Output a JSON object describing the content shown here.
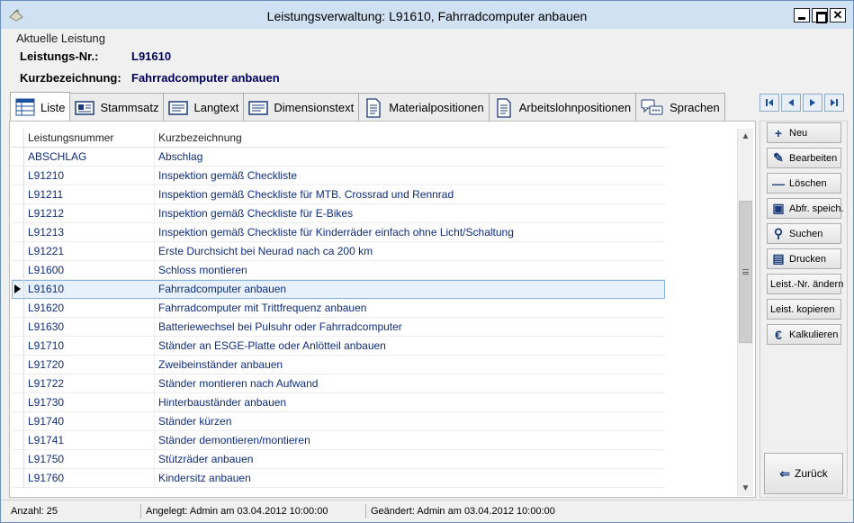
{
  "window": {
    "title": "Leistungsverwaltung: L91610, Fahrradcomputer anbauen"
  },
  "current": {
    "legend": "Aktuelle Leistung",
    "nr_label": "Leistungs-Nr.:",
    "nr_value": "L91610",
    "kurz_label": "Kurzbezeichnung:",
    "kurz_value": "Fahrradcomputer anbauen"
  },
  "tabs": [
    {
      "label": "Liste",
      "icon": "list-grid-icon",
      "active": true
    },
    {
      "label": "Stammsatz",
      "icon": "record-card-icon",
      "active": false
    },
    {
      "label": "Langtext",
      "icon": "text-lines-icon",
      "active": false
    },
    {
      "label": "Dimensionstext",
      "icon": "text-lines-icon",
      "active": false
    },
    {
      "label": "Materialpositionen",
      "icon": "document-icon",
      "active": false
    },
    {
      "label": "Arbeitslohnpositionen",
      "icon": "document-icon",
      "active": false
    },
    {
      "label": "Sprachen",
      "icon": "speech-bubble-icon",
      "active": false
    }
  ],
  "grid": {
    "headers": [
      "Leistungsnummer",
      "Kurzbezeichnung"
    ],
    "rows": [
      [
        "ABSCHLAG",
        "Abschlag"
      ],
      [
        "L91210",
        "Inspektion gemäß Checkliste"
      ],
      [
        "L91211",
        "Inspektion gemäß Checkliste für MTB. Crossrad und Rennrad"
      ],
      [
        "L91212",
        "Inspektion gemäß Checkliste für E-Bikes"
      ],
      [
        "L91213",
        "Inspektion gemäß Checkliste für Kinderräder einfach ohne Licht/Schaltung"
      ],
      [
        "L91221",
        "Erste Durchsicht  bei Neurad nach ca 200 km"
      ],
      [
        "L91600",
        "Schloss montieren"
      ],
      [
        "L91610",
        "Fahrradcomputer anbauen"
      ],
      [
        "L91620",
        "Fahrradcomputer mit Trittfrequenz anbauen"
      ],
      [
        "L91630",
        "Batteriewechsel bei Pulsuhr oder Fahrradcomputer"
      ],
      [
        "L91710",
        "Ständer an ESGE-Platte oder Anlötteil anbauen"
      ],
      [
        "L91720",
        "Zweibeinständer anbauen"
      ],
      [
        "L91722",
        "Ständer montieren nach Aufwand"
      ],
      [
        "L91730",
        "Hinterbauständer anbauen"
      ],
      [
        "L91740",
        "Ständer kürzen"
      ],
      [
        "L91741",
        "Ständer demontieren/montieren"
      ],
      [
        "L91750",
        "Stützräder anbauen"
      ],
      [
        "L91760",
        "Kindersitz anbauen"
      ]
    ],
    "selected_index": 7
  },
  "side_buttons": [
    {
      "label": "Neu",
      "icon": "plus-icon",
      "glyph": "+"
    },
    {
      "label": "Bearbeiten",
      "icon": "pencil-icon",
      "glyph": "✎"
    },
    {
      "label": "Löschen",
      "icon": "minus-icon",
      "glyph": "—"
    },
    {
      "label": "Abfr. speich.",
      "icon": "floppy-disk-icon",
      "glyph": "▣"
    },
    {
      "label": "Suchen",
      "icon": "magnifier-icon",
      "glyph": "⚲"
    },
    {
      "label": "Drucken",
      "icon": "printer-icon",
      "glyph": "▤"
    },
    {
      "label": "Leist.-Nr. ändern",
      "icon": "",
      "glyph": ""
    },
    {
      "label": "Leist. kopieren",
      "icon": "",
      "glyph": ""
    },
    {
      "label": "Kalkulieren",
      "icon": "euro-icon",
      "glyph": "€"
    }
  ],
  "back_button": {
    "label": "Zurück",
    "icon": "arrow-left-icon",
    "glyph": "⇐"
  },
  "status": {
    "count": "Anzahl: 25",
    "created": "Angelegt: Admin am 03.04.2012 10:00:00",
    "changed": "Geändert: Admin am 03.04.2012 10:00:00"
  }
}
